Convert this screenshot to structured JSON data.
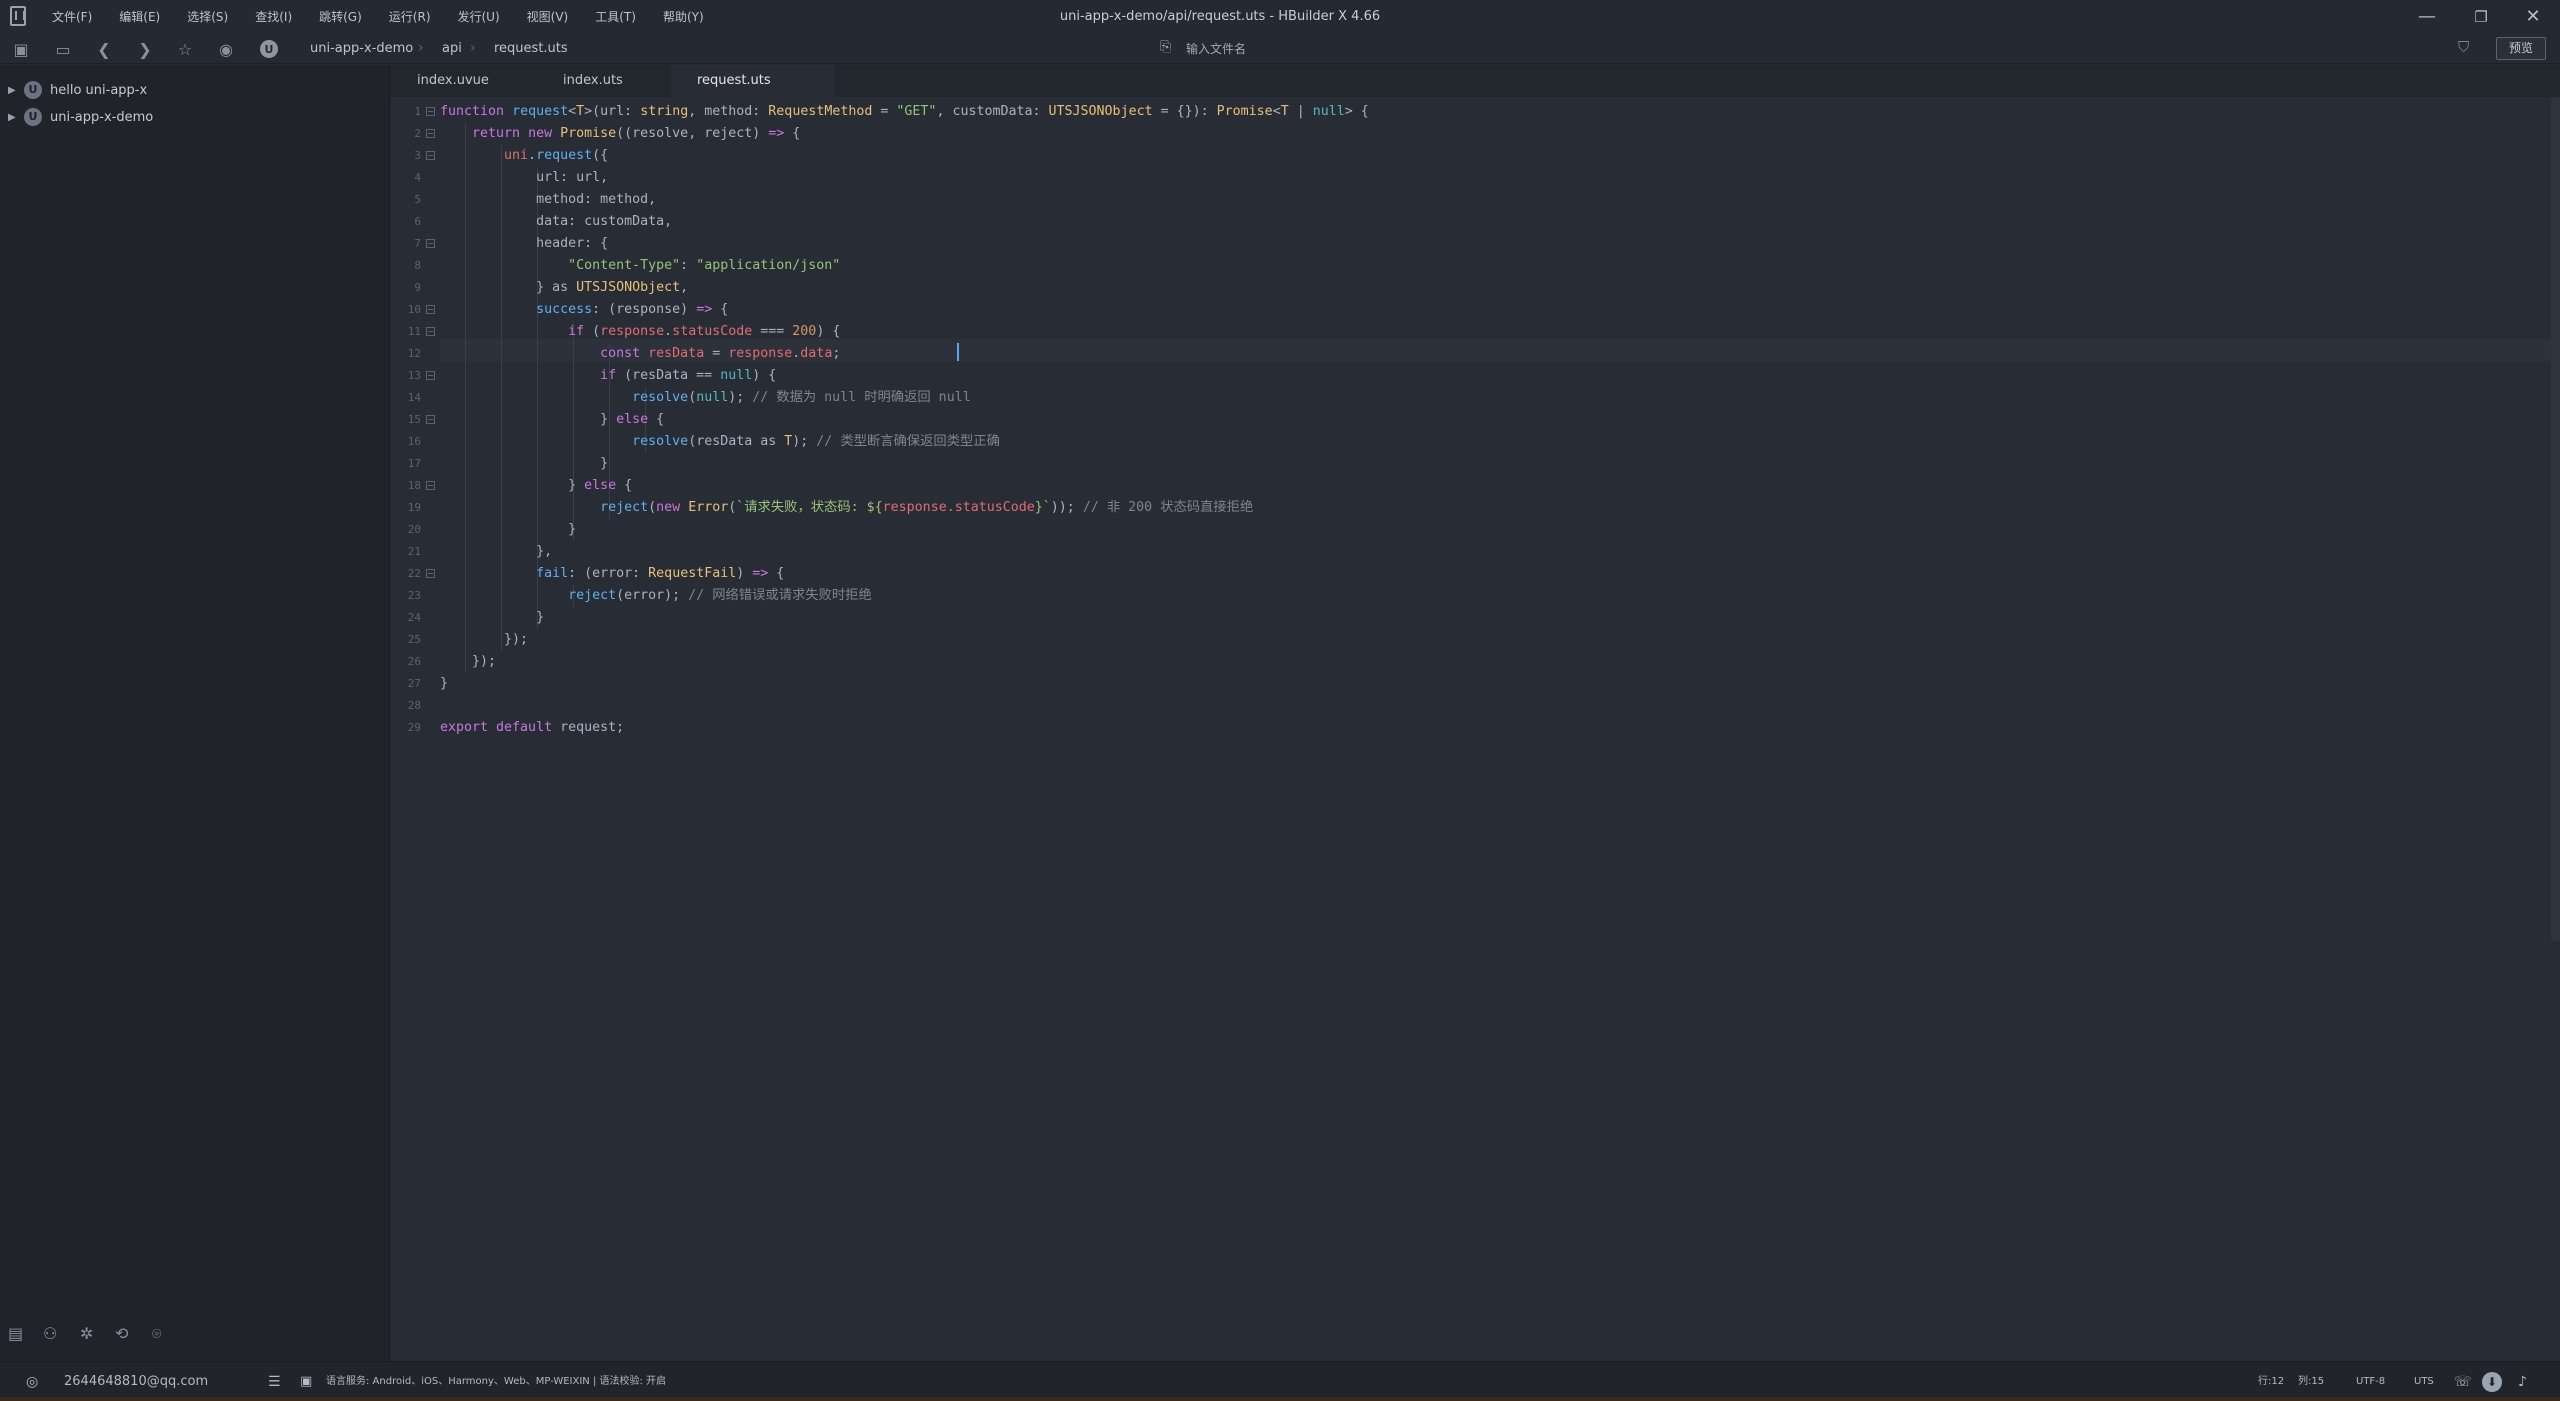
{
  "app": {
    "window_title": "uni-app-x-demo/api/request.uts - HBuilder X 4.66"
  },
  "menu": [
    "文件(F)",
    "编辑(E)",
    "选择(S)",
    "查找(I)",
    "跳转(G)",
    "运行(R)",
    "发行(U)",
    "视图(V)",
    "工具(T)",
    "帮助(Y)"
  ],
  "window_controls": {
    "minimize": "—",
    "restore": "❐",
    "close": "✕"
  },
  "toolbar": {
    "breadcrumb": [
      "uni-app-x-demo",
      "api",
      "request.uts"
    ],
    "search_placeholder": "输入文件名",
    "preview_label": "预览"
  },
  "sidebar": {
    "projects": [
      {
        "label": "hello uni-app-x"
      },
      {
        "label": "uni-app-x-demo"
      }
    ]
  },
  "tabs": [
    {
      "label": "index.uvue",
      "active": false
    },
    {
      "label": "index.uts",
      "active": false
    },
    {
      "label": "request.uts",
      "active": true
    }
  ],
  "editor": {
    "line_numbers": [
      "1",
      "2",
      "3",
      "4",
      "5",
      "6",
      "7",
      "8",
      "9",
      "10",
      "11",
      "12",
      "13",
      "14",
      "15",
      "16",
      "17",
      "18",
      "19",
      "20",
      "21",
      "22",
      "23",
      "24",
      "25",
      "26",
      "27",
      "28",
      "29"
    ],
    "fold_lines": [
      1,
      2,
      3,
      7,
      10,
      11,
      13,
      15,
      18,
      22
    ],
    "current_line": 12,
    "lines": [
      [
        [
          "kw",
          "function "
        ],
        [
          "fn",
          "request"
        ],
        [
          "pl",
          "<"
        ],
        [
          "ty",
          "T"
        ],
        [
          "pl",
          ">(url: "
        ],
        [
          "ty",
          "string"
        ],
        [
          "pl",
          ", method: "
        ],
        [
          "ty",
          "RequestMethod"
        ],
        [
          "pl",
          " = "
        ],
        [
          "st",
          "\"GET\""
        ],
        [
          "pl",
          ", customData: "
        ],
        [
          "ty",
          "UTSJSONObject"
        ],
        [
          "pl",
          " = {}): "
        ],
        [
          "ty",
          "Promise"
        ],
        [
          "pl",
          "<"
        ],
        [
          "ty",
          "T"
        ],
        [
          "pl",
          " | "
        ],
        [
          "op",
          "null"
        ],
        [
          "pl",
          "> {"
        ]
      ],
      [
        [
          "pl",
          "    "
        ],
        [
          "kw",
          "return new "
        ],
        [
          "ty",
          "Promise"
        ],
        [
          "pl",
          "((resolve, reject) "
        ],
        [
          "kw",
          "=>"
        ],
        [
          "pl",
          " {"
        ]
      ],
      [
        [
          "pl",
          "        "
        ],
        [
          "pr",
          "uni"
        ],
        [
          "pl",
          "."
        ],
        [
          "fn",
          "request"
        ],
        [
          "pl",
          "({"
        ]
      ],
      [
        [
          "pl",
          "            url: url,"
        ]
      ],
      [
        [
          "pl",
          "            method: method,"
        ]
      ],
      [
        [
          "pl",
          "            data: customData,"
        ]
      ],
      [
        [
          "pl",
          "            header: {"
        ]
      ],
      [
        [
          "pl",
          "                "
        ],
        [
          "st",
          "\"Content-Type\""
        ],
        [
          "pl",
          ": "
        ],
        [
          "st",
          "\"application/json\""
        ]
      ],
      [
        [
          "pl",
          "            } as "
        ],
        [
          "ty",
          "UTSJSONObject"
        ],
        [
          "pl",
          ","
        ]
      ],
      [
        [
          "pl",
          "            "
        ],
        [
          "fn",
          "success"
        ],
        [
          "pl",
          ": (response) "
        ],
        [
          "kw",
          "=>"
        ],
        [
          "pl",
          " {"
        ]
      ],
      [
        [
          "pl",
          "                "
        ],
        [
          "kw",
          "if"
        ],
        [
          "pl",
          " ("
        ],
        [
          "pr",
          "response"
        ],
        [
          "pl",
          "."
        ],
        [
          "pr",
          "statusCode"
        ],
        [
          "pl",
          " === "
        ],
        [
          "nu",
          "200"
        ],
        [
          "pl",
          ") {"
        ]
      ],
      [
        [
          "pl",
          "                    "
        ],
        [
          "kw",
          "const "
        ],
        [
          "pr",
          "resData"
        ],
        [
          "pl",
          " = "
        ],
        [
          "pr",
          "response"
        ],
        [
          "pl",
          "."
        ],
        [
          "pr",
          "data"
        ],
        [
          "pl",
          ";"
        ]
      ],
      [
        [
          "pl",
          "                    "
        ],
        [
          "kw",
          "if"
        ],
        [
          "pl",
          " (resData == "
        ],
        [
          "op",
          "null"
        ],
        [
          "pl",
          ") {"
        ]
      ],
      [
        [
          "pl",
          "                        "
        ],
        [
          "fn",
          "resolve"
        ],
        [
          "pl",
          "("
        ],
        [
          "op",
          "null"
        ],
        [
          "pl",
          ");"
        ],
        [
          "cm",
          " // 数据为 null 时明确返回 null"
        ]
      ],
      [
        [
          "pl",
          "                    } "
        ],
        [
          "kw",
          "else"
        ],
        [
          "pl",
          " {"
        ]
      ],
      [
        [
          "pl",
          "                        "
        ],
        [
          "fn",
          "resolve"
        ],
        [
          "pl",
          "(resData as "
        ],
        [
          "ty",
          "T"
        ],
        [
          "pl",
          ");"
        ],
        [
          "cm",
          " // 类型断言确保返回类型正确"
        ]
      ],
      [
        [
          "pl",
          "                    }"
        ]
      ],
      [
        [
          "pl",
          "                } "
        ],
        [
          "kw",
          "else"
        ],
        [
          "pl",
          " {"
        ]
      ],
      [
        [
          "pl",
          "                    "
        ],
        [
          "fn",
          "reject"
        ],
        [
          "pl",
          "("
        ],
        [
          "kw",
          "new "
        ],
        [
          "ty",
          "Error"
        ],
        [
          "pl",
          "("
        ],
        [
          "st",
          "`请求失败，状态码: ${"
        ],
        [
          "pr",
          "response.statusCode"
        ],
        [
          "st",
          "}`"
        ],
        [
          "pl",
          "));"
        ],
        [
          "cm",
          " // 非 200 状态码直接拒绝"
        ]
      ],
      [
        [
          "pl",
          "                }"
        ]
      ],
      [
        [
          "pl",
          "            },"
        ]
      ],
      [
        [
          "pl",
          "            "
        ],
        [
          "fn",
          "fail"
        ],
        [
          "pl",
          ": (error: "
        ],
        [
          "ty",
          "RequestFail"
        ],
        [
          "pl",
          ") "
        ],
        [
          "kw",
          "=>"
        ],
        [
          "pl",
          " {"
        ]
      ],
      [
        [
          "pl",
          "                "
        ],
        [
          "fn",
          "reject"
        ],
        [
          "pl",
          "(error);"
        ],
        [
          "cm",
          " // 网络错误或请求失败时拒绝"
        ]
      ],
      [
        [
          "pl",
          "            }"
        ]
      ],
      [
        [
          "pl",
          "        });"
        ]
      ],
      [
        [
          "pl",
          "    });"
        ]
      ],
      [
        [
          "pl",
          "}"
        ]
      ],
      [
        [
          "pl",
          ""
        ]
      ],
      [
        [
          "kw",
          "export default "
        ],
        [
          "pl",
          "request;"
        ]
      ]
    ]
  },
  "statusbar": {
    "account": "2644648810@qq.com",
    "platforms": "语言服务: Android、iOS、Harmony、Web、MP-WEIXIN | 语法校验: 开启",
    "position_row": "行:12",
    "position_col": "列:15",
    "encoding": "UTF-8",
    "language": "UTS"
  }
}
